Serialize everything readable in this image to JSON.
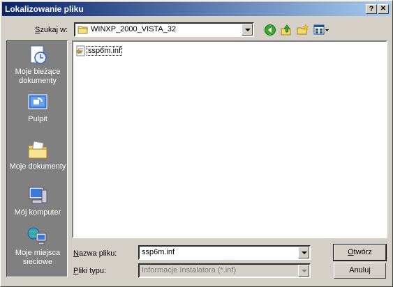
{
  "window": {
    "title": "Lokalizowanie pliku",
    "help_label": "?",
    "close_label": "✕"
  },
  "lookin": {
    "label_mnemonic": "S",
    "label_rest": "zukaj w:",
    "value": "WINXP_2000_VISTA_32"
  },
  "toolbar": {
    "icons": [
      "back-icon",
      "up-folder-icon",
      "new-folder-icon",
      "view-menu-icon"
    ]
  },
  "places": [
    {
      "label": "Moje bieżące dokumenty",
      "icon": "recent-documents-icon"
    },
    {
      "label": "Pulpit",
      "icon": "desktop-icon"
    },
    {
      "label": "Moje dokumenty",
      "icon": "my-documents-icon"
    },
    {
      "label": "Mój komputer",
      "icon": "my-computer-icon"
    },
    {
      "label": "Moje miejsca sieciowe",
      "icon": "network-places-icon"
    }
  ],
  "files": [
    {
      "name": "ssp6m.inf",
      "icon": "inf-file-icon"
    }
  ],
  "filename": {
    "label_mnemonic": "N",
    "label_rest": "azwa pliku:",
    "value": "ssp6m.inf"
  },
  "filetype": {
    "label_mnemonic": "P",
    "label_rest": "liki typu:",
    "value": "Informacje Instalatora (*.inf)"
  },
  "buttons": {
    "open_mnemonic": "O",
    "open_rest": "twórz",
    "cancel": "Anuluj"
  },
  "colors": {
    "title_start": "#0a246a",
    "title_end": "#a6caf0",
    "face": "#d4d0c8",
    "places_bg": "#808080"
  }
}
